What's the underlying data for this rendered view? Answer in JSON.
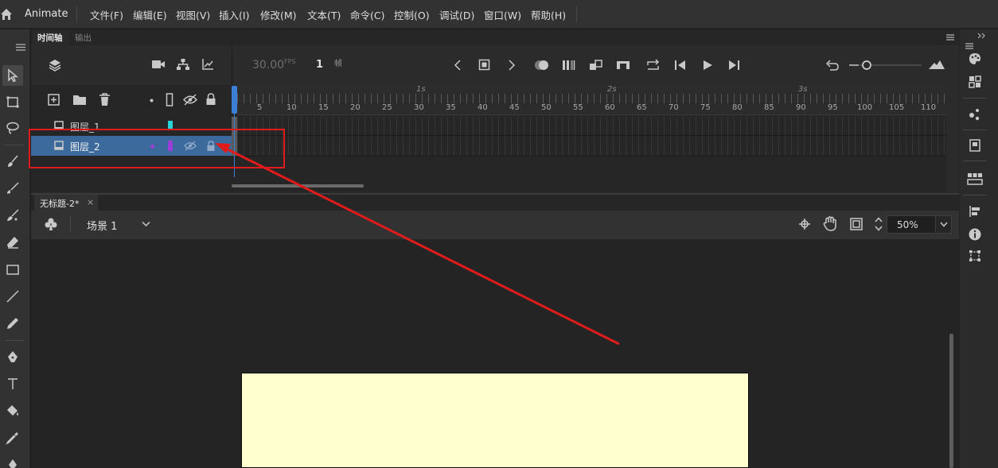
{
  "menubar": {
    "app_name": "Animate",
    "items": [
      "文件(F)",
      "编辑(E)",
      "视图(V)",
      "插入(I)",
      "修改(M)",
      "文本(T)",
      "命令(C)",
      "控制(O)",
      "调试(D)",
      "窗口(W)",
      "帮助(H)"
    ]
  },
  "timeline": {
    "tabs": [
      "时间轴",
      "输出"
    ],
    "fps": "30.00",
    "fps_unit": "FPS",
    "current_frame": "1",
    "frame_unit": "帧",
    "frame_numbers": [
      "5",
      "10",
      "15",
      "20",
      "25",
      "30",
      "35",
      "40",
      "45",
      "50",
      "55",
      "60",
      "65",
      "70",
      "75",
      "80",
      "85",
      "90",
      "95",
      "100",
      "105",
      "110"
    ],
    "seconds": [
      "1s",
      "2s",
      "3s"
    ],
    "layers": [
      {
        "name": "图层_1",
        "color": "#27d3d8",
        "selected": false
      },
      {
        "name": "图层_2",
        "color": "#9b3fd6",
        "selected": true
      }
    ]
  },
  "document": {
    "tab_title": "无标题-2*",
    "close_symbol": "×",
    "scene_label": "场景 1",
    "zoom": "50%"
  },
  "colors": {
    "canvas": "#ffffd0",
    "selection": "#3c6a9c",
    "playhead": "#3b7fd6",
    "annotation": "#e01b1b"
  }
}
